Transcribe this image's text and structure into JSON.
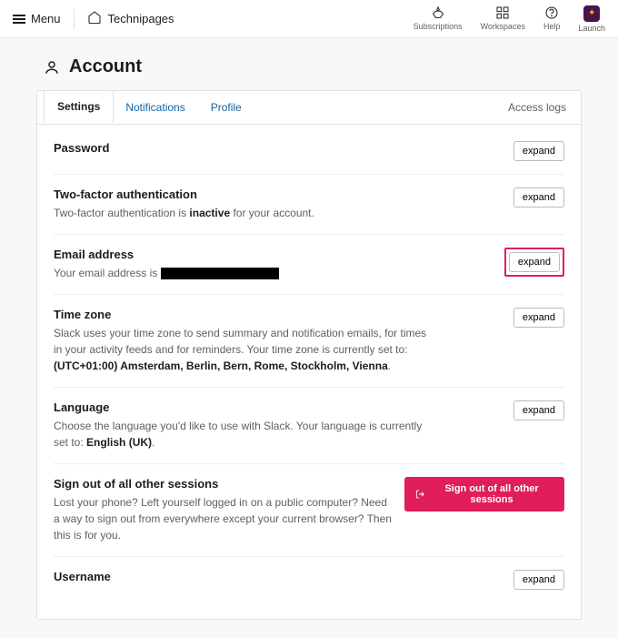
{
  "topbar": {
    "menu": "Menu",
    "workspace": "Technipages",
    "actions": {
      "subscriptions": "Subscriptions",
      "workspaces": "Workspaces",
      "help": "Help",
      "launch": "Launch"
    }
  },
  "page": {
    "title": "Account"
  },
  "tabs": {
    "settings": "Settings",
    "notifications": "Notifications",
    "profile": "Profile",
    "access_logs": "Access logs"
  },
  "sections": {
    "password": {
      "title": "Password",
      "expand": "expand"
    },
    "twofa": {
      "title": "Two-factor authentication",
      "desc_pre": "Two-factor authentication is ",
      "desc_status": "inactive",
      "desc_post": " for your account.",
      "expand": "expand"
    },
    "email": {
      "title": "Email address",
      "desc_pre": "Your email address is ",
      "expand": "expand"
    },
    "timezone": {
      "title": "Time zone",
      "desc_pre": "Slack uses your time zone to send summary and notification emails, for times in your activity feeds and for reminders. Your time zone is currently set to: ",
      "value": "(UTC+01:00) Amsterdam, Berlin, Bern, Rome, Stockholm, Vienna",
      "expand": "expand"
    },
    "language": {
      "title": "Language",
      "desc_pre": "Choose the language you'd like to use with Slack. Your language is currently set to: ",
      "value": "English (UK)",
      "expand": "expand"
    },
    "signout": {
      "title": "Sign out of all other sessions",
      "desc": "Lost your phone? Left yourself logged in on a public computer? Need a way to sign out from everywhere except your current browser? Then this is for you.",
      "button": "Sign out of all other sessions"
    },
    "username": {
      "title": "Username",
      "expand": "expand"
    }
  }
}
